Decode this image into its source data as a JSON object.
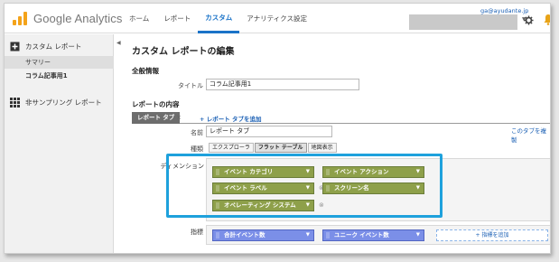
{
  "header": {
    "logo_text": "Google Analytics",
    "nav": [
      {
        "label": "ホーム",
        "active": false
      },
      {
        "label": "レポート",
        "active": false
      },
      {
        "label": "カスタム",
        "active": true
      },
      {
        "label": "アナリティクス設定",
        "active": false
      }
    ],
    "account_email": "ga@ayudante.jp",
    "accent_color": "#1a73c8"
  },
  "sidebar": {
    "custom_reports_label": "カスタム レポート",
    "items": [
      {
        "label": "サマリー",
        "selected": true
      },
      {
        "label": "コラム記事用1",
        "selected": false
      }
    ],
    "unsampled_label": "非サンプリング レポート"
  },
  "main": {
    "page_title": "カスタム レポートの編集",
    "general_section": "全般情報",
    "title_label": "タイトル",
    "title_value": "コラム記事用1",
    "content_section": "レポートの内容",
    "report_tab_label": "レポート タブ",
    "tab_close": "×",
    "add_tab_label": "+ レポート タブを追加",
    "copy_tab_label": "このタブを複製",
    "name_label": "名前",
    "name_value": "レポート タブ",
    "type_label": "種類",
    "type_tabs": [
      {
        "label": "エクスプローラ",
        "selected": false
      },
      {
        "label": "フラット テーブル",
        "selected": true
      },
      {
        "label": "地図表示",
        "selected": false
      }
    ],
    "dimension_label": "ディメンション",
    "dimensions": [
      {
        "label": "イベント カテゴリ"
      },
      {
        "label": "イベント アクション"
      },
      {
        "label": "イベント ラベル"
      },
      {
        "label": "スクリーン名"
      },
      {
        "label": "オペレーティング システム"
      }
    ],
    "metric_label": "指標",
    "metrics": [
      {
        "label": "合計イベント数"
      },
      {
        "label": "ユニーク イベント数"
      }
    ],
    "add_metric_label": "+ 指標を追加",
    "dimension_color": "#8ea04a",
    "metric_color": "#7b8fe8",
    "highlight_color": "#1ea1dc"
  }
}
